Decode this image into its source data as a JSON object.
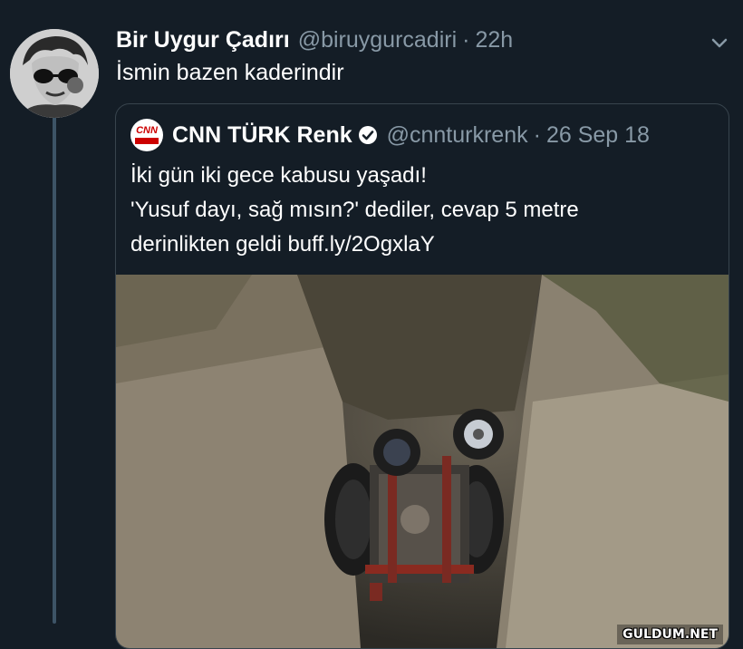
{
  "tweet": {
    "display_name": "Bir Uygur Çadırı",
    "handle": "@biruygurcadiri",
    "separator": "·",
    "time": "22h",
    "text": "İsmin bazen kaderindir",
    "avatar_icon": "avatar-photo",
    "caret_icon": "chevron-down-icon"
  },
  "quoted_tweet": {
    "display_name": "CNN TÜRK Renk",
    "handle": "@cnnturkrenk",
    "separator": "·",
    "date": "26 Sep 18",
    "logo_text": "CNN",
    "verified_icon": "verified-badge-icon",
    "lines": [
      "İki gün iki gece kabusu yaşadı!",
      "'Yusuf dayı, sağ mısın?' dediler, cevap 5 metre",
      "derinlikten geldi buff.ly/2OgxlaY"
    ],
    "media_alt": "overturned-tractor-in-ditch-photo"
  },
  "watermark": "GULDUM.NET",
  "colors": {
    "background": "#141d26",
    "secondary_text": "#8899a6",
    "border": "#38444d",
    "thread_line": "#3d5466"
  }
}
